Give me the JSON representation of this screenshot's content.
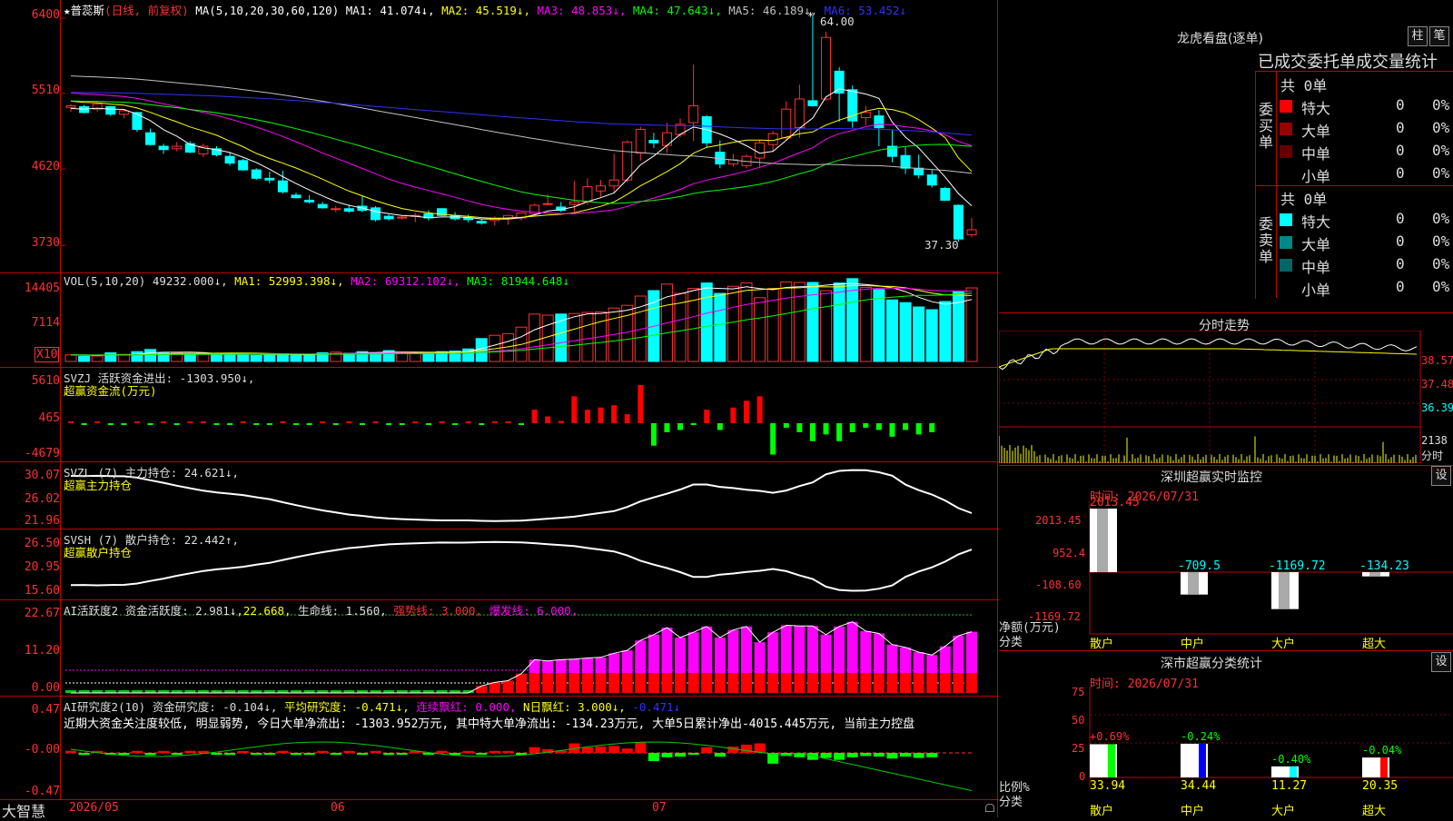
{
  "colors": {
    "up": "#ff3030",
    "down": "#00ffff",
    "vol_up": "#ff3030",
    "vol_down": "#00ffff",
    "ma1": "#ffffff",
    "ma2": "#ffff00",
    "ma3": "#ff00ff",
    "ma4": "#00ff00",
    "ma5": "#c0c0c0",
    "ma6": "#3030ff",
    "grid": "#c00000"
  },
  "header": {
    "star": "★",
    "stock_name": "普蕊斯",
    "period": "(日线, 前复权)",
    "ma_params": "MA(5,10,20,30,60,120)",
    "ma1": "MA1: 41.074↓,",
    "ma2": "MA2: 45.519↓,",
    "ma3": "MA3: 48.853↓,",
    "ma4": "MA4: 47.643↓,",
    "ma5": "MA5: 46.189↓,",
    "ma6": "MA6: 53.452↓"
  },
  "main_axis": {
    "ticks": [
      "6400",
      "5510",
      "4620",
      "3730"
    ],
    "high_label": "64.00",
    "low_label": "37.30"
  },
  "vol": {
    "label": "VOL(5,10,20)",
    "value": "49232.000↓,",
    "ma1": "MA1: 52993.398↓,",
    "ma2": "MA2: 69312.102↓,",
    "ma3": "MA3: 81944.648↓",
    "ticks": [
      "14405",
      "7114"
    ],
    "unit": "X10"
  },
  "svzj": {
    "label": "SVZJ  活跃资金进出: -1303.950↓,",
    "sub": "超赢资金流(万元)",
    "ticks": [
      "5610",
      "465",
      "-4679"
    ]
  },
  "svzl": {
    "label": "SVZL (7) 主力持仓: 24.621↓,",
    "sub": "超赢主力持仓",
    "ticks": [
      "30.07",
      "26.02",
      "21.96"
    ]
  },
  "svsh": {
    "label": "SVSH (7) 散户持仓: 22.442↑,",
    "sub": "超赢散户持仓",
    "ticks": [
      "26.50",
      "20.95",
      "15.60"
    ]
  },
  "huoyue": {
    "label": "AI活跃度2 资金活跃度: 2.981↓,",
    "v2": "22.668,",
    "v3": "生命线: 1.560,",
    "v4": "强势线: 3.000,",
    "v5": "爆发线: 6.000,",
    "ticks": [
      "22.67",
      "11.20",
      "0.00"
    ]
  },
  "yanjiu": {
    "label": "AI研究度2(10) 资金研究度: -0.104↓,",
    "v2": "平均研究度: -0.471↓,",
    "v3": "连续飘红: 0.000,",
    "v4": "N日飘红: 3.000↓,",
    "v5": "-0.471↓",
    "comment": "近期大资金关注度较低, 明显弱势, 今日大单净流出: -1303.952万元, 其中特大单净流出: -134.23万元, 大单5日累计净出-4015.445万元, 当前主力控盘",
    "ticks": [
      "0.47",
      "-0.00",
      "-0.47"
    ]
  },
  "xaxis": {
    "logo": "大智慧",
    "labels": [
      "2026/05",
      "06",
      "07"
    ]
  },
  "right": {
    "lhb_title": "龙虎看盘(逐单)",
    "btn1": "柱",
    "btn2": "笔",
    "order_title": "已成交委托单成交量统计",
    "buy_side": "委买单",
    "sell_side": "委卖单",
    "buy_total": "共 0单",
    "sell_total": "共 0单",
    "buy_rows": [
      {
        "name": "特大",
        "v": "0",
        "p": "0%",
        "color": "#ff0000"
      },
      {
        "name": "大单",
        "v": "0",
        "p": "0%",
        "color": "#990000"
      },
      {
        "name": "中单",
        "v": "0",
        "p": "0%",
        "color": "#660000"
      },
      {
        "name": "小单",
        "v": "0",
        "p": "0%",
        "color": ""
      }
    ],
    "sell_rows": [
      {
        "name": "特大",
        "v": "0",
        "p": "0%",
        "color": "#00ffff"
      },
      {
        "name": "大单",
        "v": "0",
        "p": "0%",
        "color": "#008888"
      },
      {
        "name": "中单",
        "v": "0",
        "p": "0%",
        "color": "#006666"
      },
      {
        "name": "小单",
        "v": "0",
        "p": "0%",
        "color": ""
      }
    ],
    "fenshi_title": "分时走势",
    "fenshi_ticks": [
      "38.57",
      "37.48",
      "36.39",
      "2138"
    ],
    "fenshi_unit": "分时",
    "sz_title": "深圳超赢实时监控",
    "sz_btn": "设",
    "sz_time": "时间: 2026/07/31",
    "sz_ticks": [
      "2013.45",
      "952.4",
      "-108.60",
      "-1169.72"
    ],
    "sz_axis_label": "净额(万元)",
    "sz_axis_label2": "分类",
    "sz_bars": [
      {
        "cat": "散户",
        "value": "2013.45"
      },
      {
        "cat": "中户",
        "value": "-709.5"
      },
      {
        "cat": "大户",
        "value": "-1169.72"
      },
      {
        "cat": "超大",
        "value": "-134.23"
      }
    ],
    "fl_title": "深市超赢分类统计",
    "fl_btn": "设",
    "fl_time": "时间: 2026/07/31",
    "fl_ticks": [
      "75",
      "50",
      "25",
      "0"
    ],
    "fl_axis_label": "比例%",
    "fl_axis_label2": "分类",
    "fl_bars": [
      {
        "cat": "散户",
        "value": "33.94",
        "delta": "+0.69%"
      },
      {
        "cat": "中户",
        "value": "34.44",
        "delta": "-0.24%"
      },
      {
        "cat": "大户",
        "value": "11.27",
        "delta": "-0.40%"
      },
      {
        "cat": "超大",
        "value": "20.35",
        "delta": "-0.04%"
      }
    ]
  },
  "chart_data": [
    {
      "type": "candlestick",
      "title": "普蕊斯 (日线, 前复权)",
      "ylim": [
        37.3,
        64.0
      ],
      "candles": [
        [
          53.2,
          53.6,
          52.7,
          53.4
        ],
        [
          53.3,
          53.5,
          52.5,
          52.6
        ],
        [
          53.0,
          53.8,
          52.7,
          53.6
        ],
        [
          53.3,
          53.4,
          52.2,
          52.4
        ],
        [
          52.4,
          52.9,
          51.9,
          52.8
        ],
        [
          52.6,
          52.7,
          50.3,
          50.6
        ],
        [
          50.2,
          50.7,
          48.7,
          48.8
        ],
        [
          48.6,
          48.9,
          47.7,
          48.2
        ],
        [
          48.3,
          49.1,
          48.0,
          48.6
        ],
        [
          48.9,
          49.2,
          47.8,
          47.9
        ],
        [
          47.7,
          48.9,
          47.3,
          48.6
        ],
        [
          48.3,
          48.6,
          47.4,
          47.6
        ],
        [
          47.4,
          47.9,
          46.3,
          46.6
        ],
        [
          46.9,
          47.1,
          45.7,
          45.8
        ],
        [
          45.8,
          46.0,
          44.6,
          44.8
        ],
        [
          44.8,
          45.6,
          44.2,
          44.6
        ],
        [
          44.5,
          45.7,
          43.0,
          43.2
        ],
        [
          42.8,
          43.1,
          42.4,
          42.5
        ],
        [
          42.2,
          42.8,
          41.8,
          42.0
        ],
        [
          41.7,
          42.0,
          41.2,
          41.3
        ],
        [
          41.1,
          41.5,
          40.8,
          41.2
        ],
        [
          41.2,
          41.7,
          40.7,
          40.9
        ],
        [
          41.5,
          42.8,
          40.8,
          41.0
        ],
        [
          41.3,
          41.5,
          39.7,
          39.9
        ],
        [
          40.3,
          40.5,
          39.8,
          40.0
        ],
        [
          40.1,
          40.4,
          39.9,
          40.2
        ],
        [
          40.3,
          40.7,
          39.6,
          40.4
        ],
        [
          40.6,
          41.0,
          39.8,
          40.1
        ],
        [
          41.2,
          41.2,
          40.3,
          40.4
        ],
        [
          40.4,
          40.8,
          39.8,
          40.0
        ],
        [
          40.1,
          40.5,
          39.6,
          39.9
        ],
        [
          39.7,
          40.0,
          39.3,
          39.5
        ],
        [
          39.8,
          40.3,
          39.2,
          40.1
        ],
        [
          40.0,
          40.3,
          39.3,
          40.4
        ],
        [
          40.1,
          40.8,
          39.8,
          40.7
        ],
        [
          40.6,
          41.8,
          40.3,
          41.6
        ],
        [
          41.7,
          42.9,
          41.6,
          41.8
        ],
        [
          41.4,
          42.0,
          40.8,
          41.0
        ],
        [
          41.7,
          44.5,
          40.7,
          42.0
        ],
        [
          42.0,
          44.8,
          41.7,
          43.8
        ],
        [
          43.3,
          44.6,
          42.6,
          43.9
        ],
        [
          43.9,
          47.7,
          43.0,
          44.6
        ],
        [
          44.6,
          49.3,
          44.3,
          49.1
        ],
        [
          47.8,
          50.9,
          46.9,
          50.6
        ],
        [
          49.3,
          50.2,
          48.4,
          49.0
        ],
        [
          48.7,
          51.4,
          47.8,
          50.2
        ],
        [
          50.0,
          51.9,
          49.7,
          51.2
        ],
        [
          51.4,
          58.3,
          49.2,
          53.4
        ],
        [
          52.1,
          52.3,
          48.5,
          49.0
        ],
        [
          47.9,
          49.3,
          46.0,
          46.5
        ],
        [
          46.5,
          47.7,
          46.2,
          47.0
        ],
        [
          46.3,
          47.6,
          46.0,
          47.4
        ],
        [
          47.2,
          49.3,
          46.0,
          49.0
        ],
        [
          48.8,
          50.4,
          47.9,
          50.1
        ],
        [
          49.6,
          53.9,
          49.3,
          53.0
        ],
        [
          50.8,
          55.9,
          49.6,
          54.2
        ],
        [
          54.0,
          64.0,
          53.3,
          53.4
        ],
        [
          54.2,
          62.2,
          54.0,
          61.5
        ],
        [
          57.5,
          58.0,
          51.5,
          54.9
        ],
        [
          55.3,
          55.8,
          50.8,
          51.6
        ],
        [
          52.0,
          53.4,
          51.1,
          52.6
        ],
        [
          52.2,
          52.9,
          48.6,
          50.8
        ],
        [
          48.6,
          50.5,
          46.7,
          47.4
        ],
        [
          47.5,
          48.5,
          45.3,
          46.0
        ],
        [
          46.0,
          47.6,
          44.8,
          45.2
        ],
        [
          45.2,
          45.8,
          43.7,
          44.0
        ],
        [
          43.6,
          43.8,
          42.1,
          42.2
        ],
        [
          41.6,
          41.7,
          37.3,
          37.6
        ],
        [
          38.1,
          40.1,
          37.8,
          38.7
        ]
      ]
    },
    {
      "type": "bar",
      "title": "VOL(5,10,20)",
      "values": [
        120,
        95,
        100,
        160,
        130,
        180,
        220,
        150,
        160,
        140,
        150,
        135,
        130,
        140,
        110,
        120,
        140,
        115,
        130,
        160,
        170,
        150,
        180,
        160,
        200,
        170,
        150,
        160,
        180,
        190,
        230,
        420,
        480,
        510,
        630,
        870,
        850,
        870,
        880,
        900,
        910,
        980,
        1030,
        1200,
        1300,
        1420,
        1250,
        1340,
        1440,
        1250,
        1380,
        1440,
        1170,
        1340,
        1460,
        1450,
        1450,
        1300,
        1440,
        1520,
        1360,
        1320,
        1130,
        1080,
        1000,
        950,
        1100,
        1280,
        1350
      ],
      "ylim": [
        0,
        14405
      ]
    },
    {
      "type": "bar",
      "title": "SVZJ 活跃资金进出",
      "values": [
        40,
        -50,
        30,
        -20,
        -10,
        30,
        -80,
        20,
        -30,
        40,
        30,
        -20,
        -40,
        20,
        -30,
        -20,
        30,
        -40,
        -20,
        20,
        -30,
        30,
        -20,
        30,
        -40,
        -20,
        20,
        -30,
        40,
        -20,
        20,
        -30,
        30,
        10,
        -20,
        600,
        300,
        100,
        1200,
        600,
        700,
        800,
        400,
        1700,
        -1000,
        -400,
        -300,
        -20,
        600,
        -300,
        700,
        1000,
        1200,
        -1400,
        -200,
        -400,
        -800,
        -500,
        -800,
        -400,
        -200,
        -300,
        -600,
        -300,
        -500,
        -400
      ],
      "ylim": [
        -4679,
        5610
      ]
    },
    {
      "type": "line",
      "title": "SVZL 主力持仓",
      "ylim": [
        21.96,
        30.07
      ]
    },
    {
      "type": "line",
      "title": "SVSH 散户持仓",
      "ylim": [
        15.6,
        26.5
      ]
    },
    {
      "type": "bar",
      "title": "AI活跃度2",
      "ylim": [
        0,
        22.67
      ]
    },
    {
      "type": "bar",
      "title": "AI研究度2(10)",
      "ylim": [
        -0.47,
        0.47
      ]
    }
  ]
}
